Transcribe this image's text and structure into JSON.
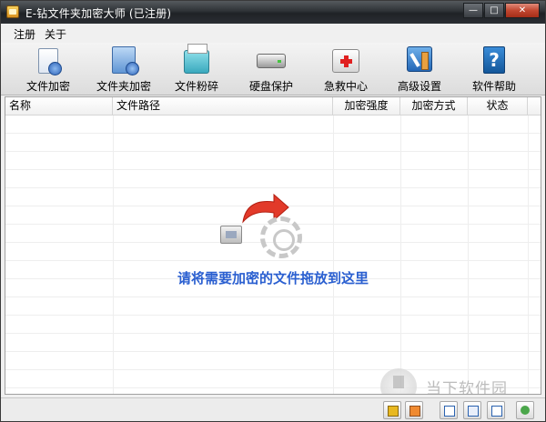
{
  "window": {
    "title": "E-钻文件夹加密大师 (已注册)"
  },
  "title_buttons": {
    "minimize": "—",
    "maximize": "□",
    "close": "✕"
  },
  "menu": [
    "注册",
    "关于"
  ],
  "toolbar": [
    {
      "label": "文件加密",
      "icon": "file-encrypt-icon"
    },
    {
      "label": "文件夹加密",
      "icon": "folder-encrypt-icon"
    },
    {
      "label": "文件粉碎",
      "icon": "file-shred-icon"
    },
    {
      "label": "硬盘保护",
      "icon": "disk-protect-icon"
    },
    {
      "label": "急救中心",
      "icon": "first-aid-icon"
    },
    {
      "label": "高级设置",
      "icon": "settings-icon"
    },
    {
      "label": "软件帮助",
      "icon": "help-icon"
    }
  ],
  "list": {
    "columns": [
      "名称",
      "文件路径",
      "加密强度",
      "加密方式",
      "状态"
    ],
    "rows": []
  },
  "drop_hint": "请将需要加密的文件拖放到这里",
  "watermark": "当下软件园",
  "statusbar": [
    "lock-icon",
    "unlock-icon",
    "view-icon",
    "view-list-icon",
    "view-detail-icon",
    "refresh-icon"
  ]
}
